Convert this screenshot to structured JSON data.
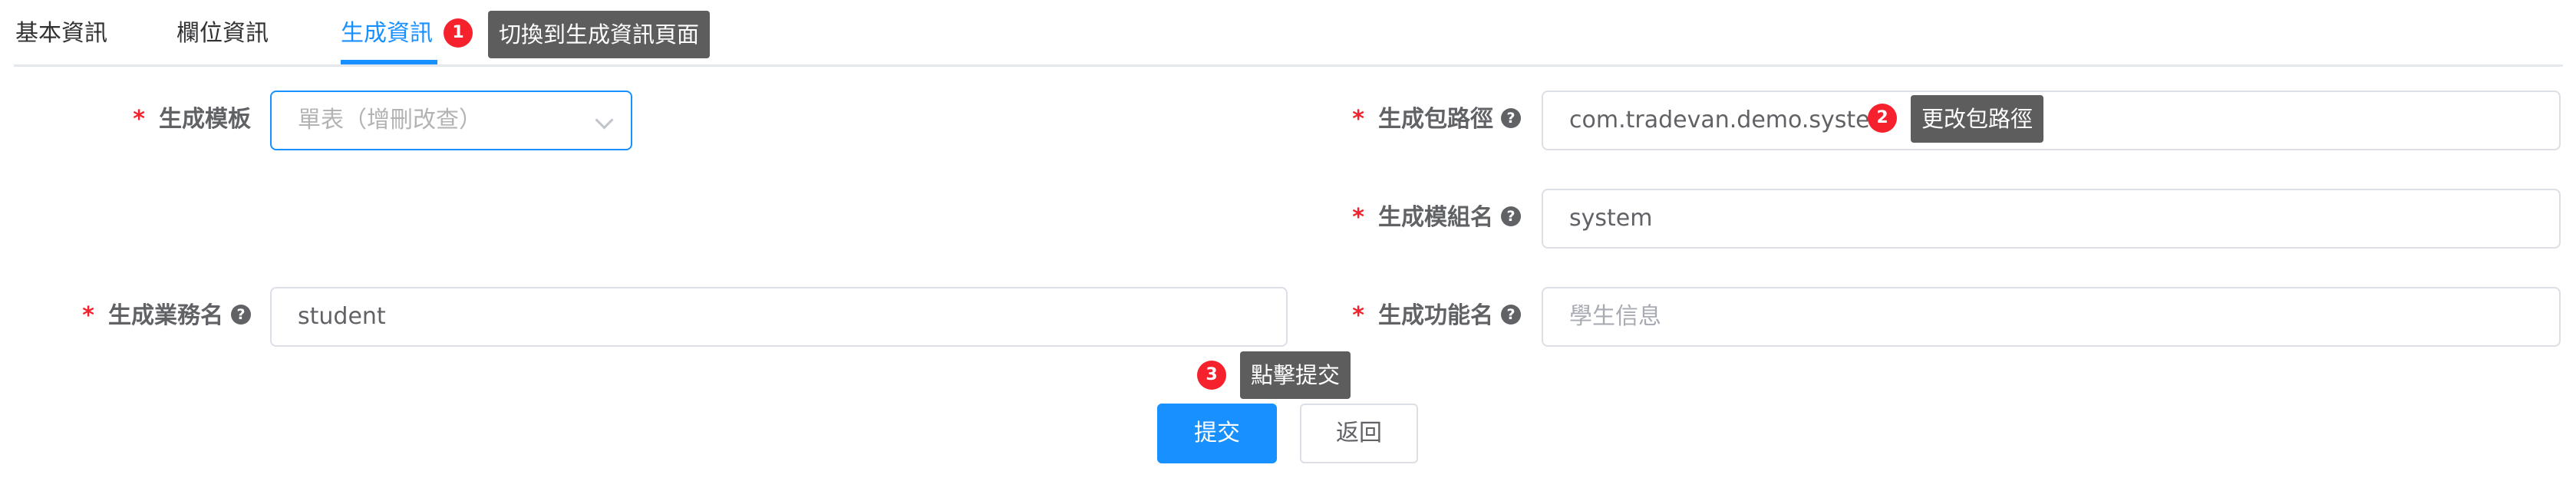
{
  "tabs": {
    "basic": "基本資訊",
    "fields": "欄位資訊",
    "gen": "生成資訊"
  },
  "annotations": {
    "step1": {
      "num": "1",
      "text": "切換到生成資訊頁面"
    },
    "step2": {
      "num": "2",
      "text": "更改包路徑"
    },
    "step3": {
      "num": "3",
      "text": "點擊提交"
    }
  },
  "form": {
    "template": {
      "label": "生成模板",
      "value": "單表（增刪改查）"
    },
    "package": {
      "label": "生成包路徑",
      "value": "com.tradevan.demo.system"
    },
    "module": {
      "label": "生成模組名",
      "value": "system"
    },
    "business": {
      "label": "生成業務名",
      "value": "student"
    },
    "function": {
      "label": "生成功能名",
      "placeholder": "學生信息"
    }
  },
  "buttons": {
    "submit": "提交",
    "back": "返回"
  },
  "colors": {
    "accent": "#1890ff",
    "required": "#f5222d",
    "tooltip_bg": "#5d5d5d"
  }
}
